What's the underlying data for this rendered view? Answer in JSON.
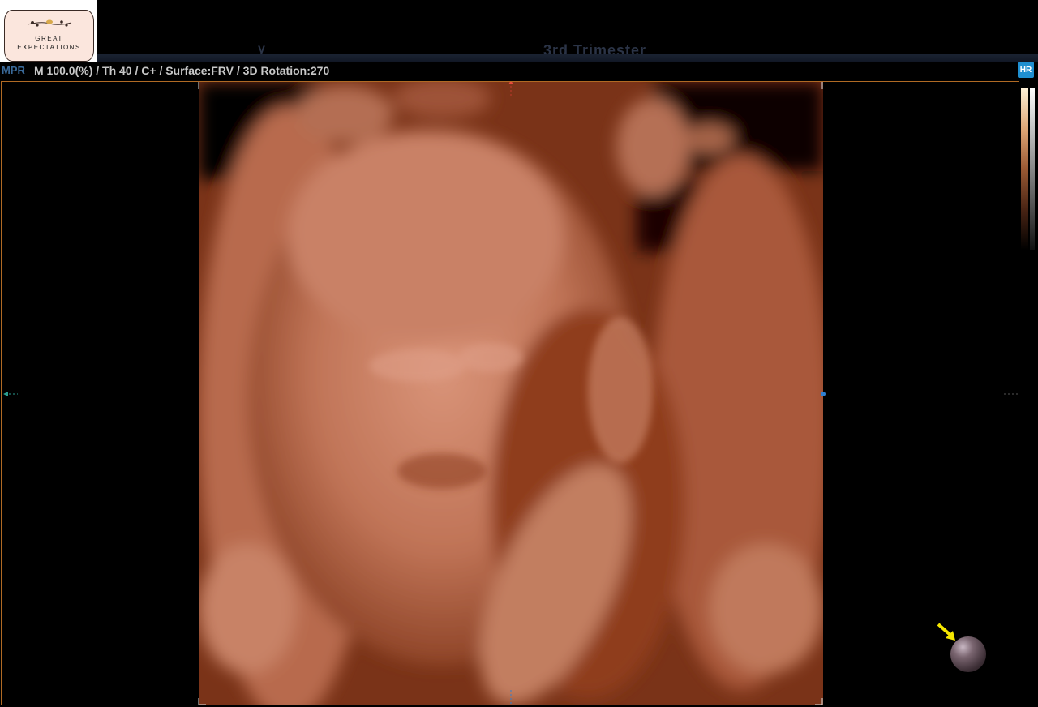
{
  "header": {
    "faded_title": "3rd Trimester",
    "faded_left": "y"
  },
  "logo": {
    "line1": "GREAT",
    "line2": "EXPECTATIONS"
  },
  "info_bar": {
    "prefix": "MPR",
    "params": "M 100.0(%) / Th 40 / C+ / Surface:FRV / 3D Rotation:270",
    "hr_badge": "HR"
  },
  "viewport": {
    "frame_color": "#b06a24",
    "render_tone": "#c98064"
  },
  "icons": {
    "orientation": "orientation-ball-icon",
    "pointer": "yellow-arrow-icon"
  }
}
